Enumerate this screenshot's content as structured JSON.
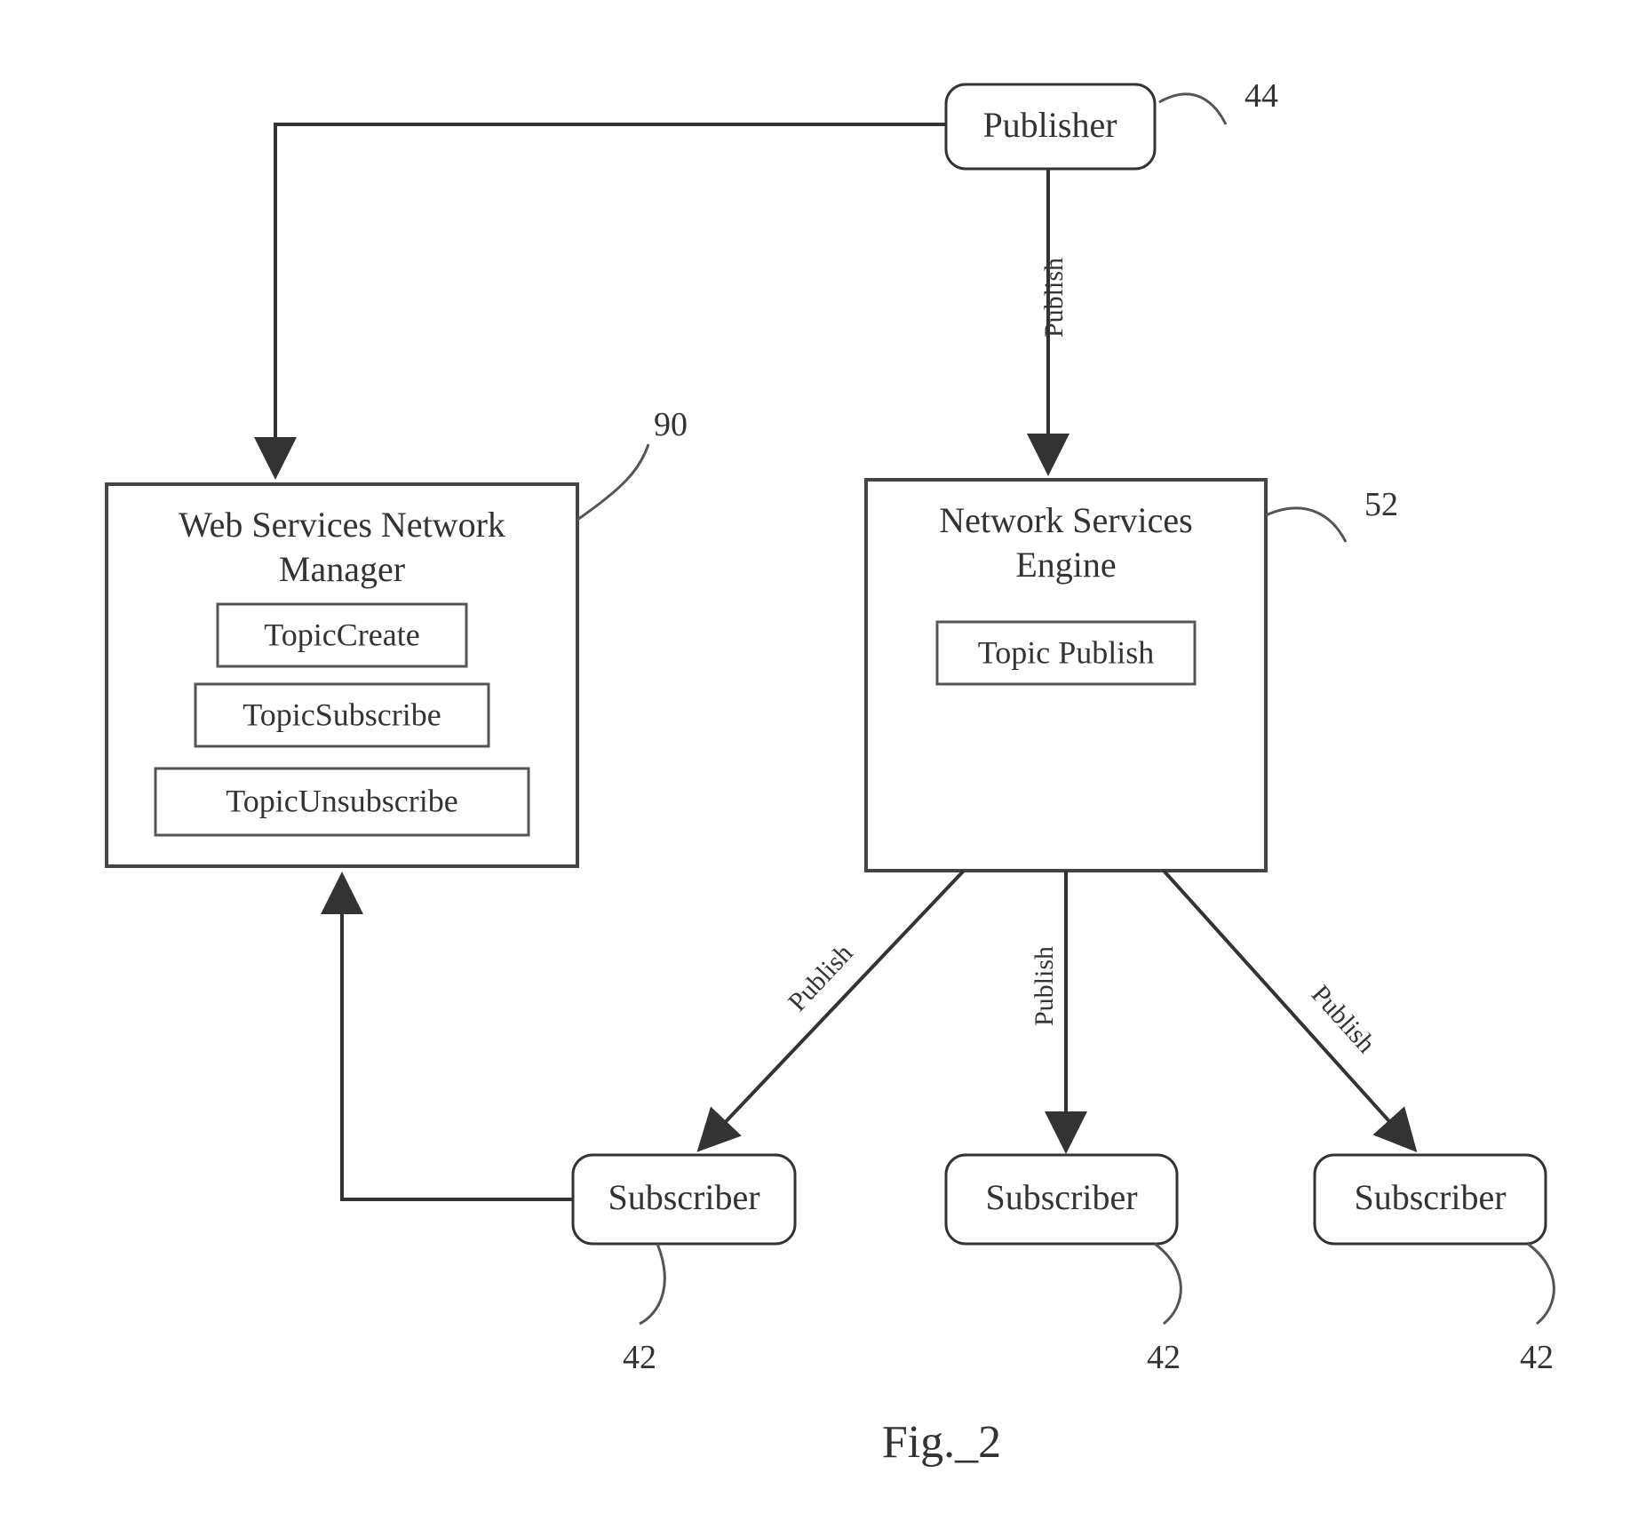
{
  "nodes": {
    "publisher": {
      "label": "Publisher",
      "ref": "44"
    },
    "wsnm": {
      "title_line1": "Web Services Network",
      "title_line2": "Manager",
      "ref": "90",
      "items": {
        "topic_create": "TopicCreate",
        "topic_subscribe": "TopicSubscribe",
        "topic_unsubscribe": "TopicUnsubscribe"
      }
    },
    "nse": {
      "title_line1": "Network Services",
      "title_line2": "Engine",
      "ref": "52",
      "items": {
        "topic_publish": "Topic Publish"
      }
    },
    "subscribers": [
      {
        "label": "Subscriber",
        "ref": "42"
      },
      {
        "label": "Subscriber",
        "ref": "42"
      },
      {
        "label": "Subscriber",
        "ref": "42"
      }
    ]
  },
  "edges": {
    "publisher_to_nse": "Publish",
    "nse_to_sub1": "Publish",
    "nse_to_sub2": "Publish",
    "nse_to_sub3": "Publish"
  },
  "figure_caption": "Fig._2"
}
